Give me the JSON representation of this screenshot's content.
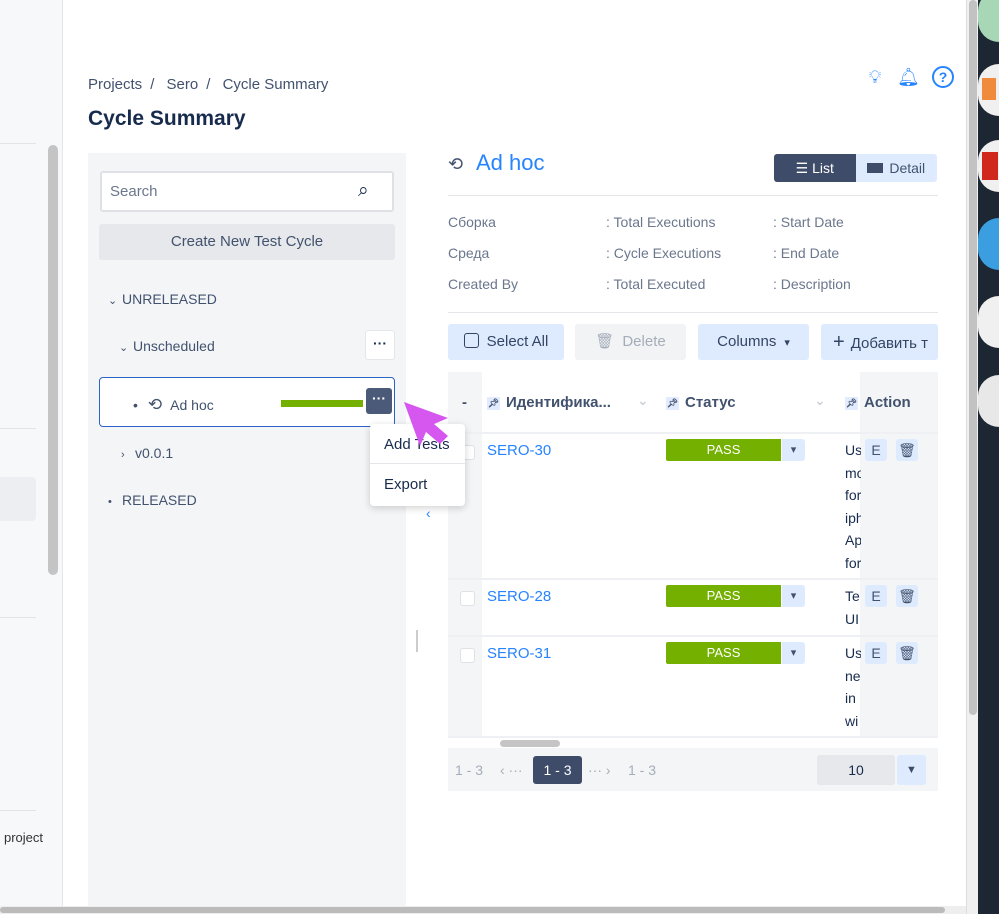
{
  "sidebar_bg": {
    "footer_text": "project"
  },
  "breadcrumb": [
    "Projects",
    "Sero",
    "Cycle Summary"
  ],
  "page_title": "Cycle Summary",
  "header_icons": [
    "lightbulb-icon",
    "bell-icon",
    "help-icon"
  ],
  "tree": {
    "search_placeholder": "Search",
    "create_label": "Create New Test Cycle",
    "unreleased": "UNRELEASED",
    "unscheduled": "Unscheduled",
    "adhoc": "Ad hoc",
    "adhoc_progress": 1.0,
    "version": "v0.0.1",
    "released": "RELEASED",
    "menu": [
      "Add Tests",
      "Export"
    ],
    "dots": "···"
  },
  "cycle": {
    "title": "Ad hoc",
    "views": {
      "list": "List",
      "detail": "Detail",
      "active": "list"
    },
    "info": [
      [
        "Сборка",
        ": Total Executions",
        ": Start Date"
      ],
      [
        "Среда",
        ": Cycle Executions",
        ": End Date"
      ],
      [
        "Created By",
        ": Total Executed",
        ": Description"
      ]
    ],
    "toolbar": {
      "select_all": "Select All",
      "delete": "Delete",
      "columns": "Columns",
      "add": "Добавить т"
    },
    "columns": {
      "dash": "-",
      "id": "Идентифика...",
      "status": "Статус",
      "action": "Action"
    },
    "rows": [
      {
        "id": "SERO-30",
        "status": "PASS",
        "desc": [
          "Us",
          "mo",
          "for",
          "iph",
          "Ap",
          "for"
        ],
        "edit": "E"
      },
      {
        "id": "SERO-28",
        "status": "PASS",
        "desc": [
          "Te",
          "UI"
        ],
        "edit": "E"
      },
      {
        "id": "SERO-31",
        "status": "PASS",
        "desc": [
          "Us",
          "ne",
          "in",
          "wi"
        ],
        "edit": "E"
      }
    ],
    "status_color": "#74b000",
    "pager": {
      "first": "1 - 3",
      "current": "1 - 3",
      "last": "1 - 3",
      "prev": "‹ ···",
      "next": "··· ›",
      "page_size": "10"
    }
  }
}
